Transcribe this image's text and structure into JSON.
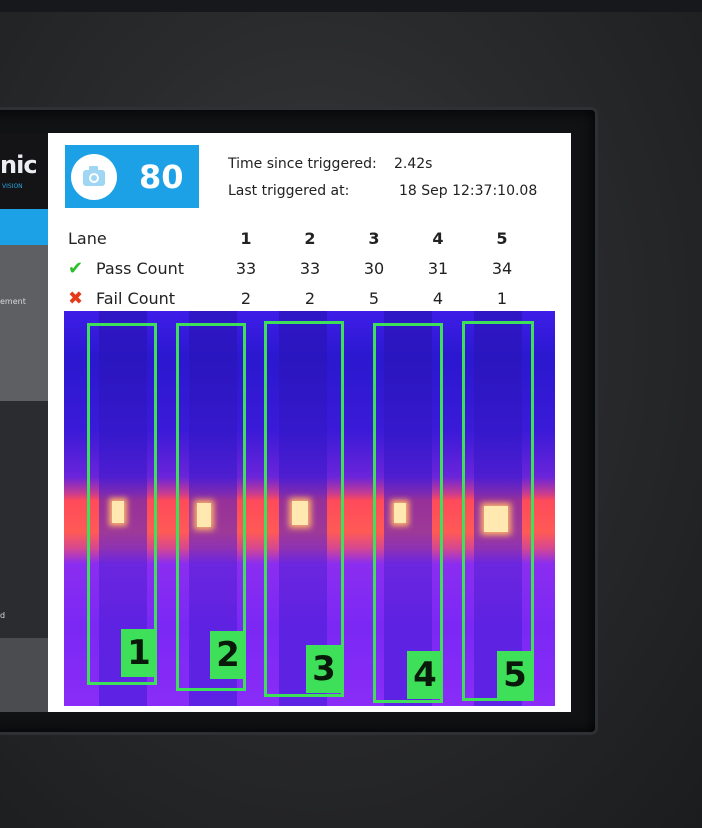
{
  "sidebar": {
    "logo_text": "nic",
    "logo_sub": "VISION",
    "item_partial_1": "ement",
    "item_partial_2": "d"
  },
  "camera": {
    "icon": "camera-icon",
    "count": "80"
  },
  "status": {
    "time_since_label": "Time since triggered:",
    "time_since_value": "2.42s",
    "last_triggered_label": "Last triggered at:",
    "last_triggered_value": "18 Sep 12:37:10.08"
  },
  "lanes_table": {
    "header": "Lane",
    "lanes": [
      "1",
      "2",
      "3",
      "4",
      "5"
    ],
    "pass_label": "Pass Count",
    "pass_icon": "check-icon",
    "pass_counts": [
      "33",
      "33",
      "30",
      "31",
      "34"
    ],
    "fail_label": "Fail Count",
    "fail_icon": "cross-icon",
    "fail_counts": [
      "2",
      "2",
      "5",
      "4",
      "1"
    ]
  },
  "thermal_view": {
    "lane_tags": [
      "1",
      "2",
      "3",
      "4",
      "5"
    ]
  },
  "colors": {
    "accent": "#1da1e6",
    "lane_box": "#3ee05a",
    "pass": "#2bbf2b",
    "fail": "#e43a1a"
  }
}
